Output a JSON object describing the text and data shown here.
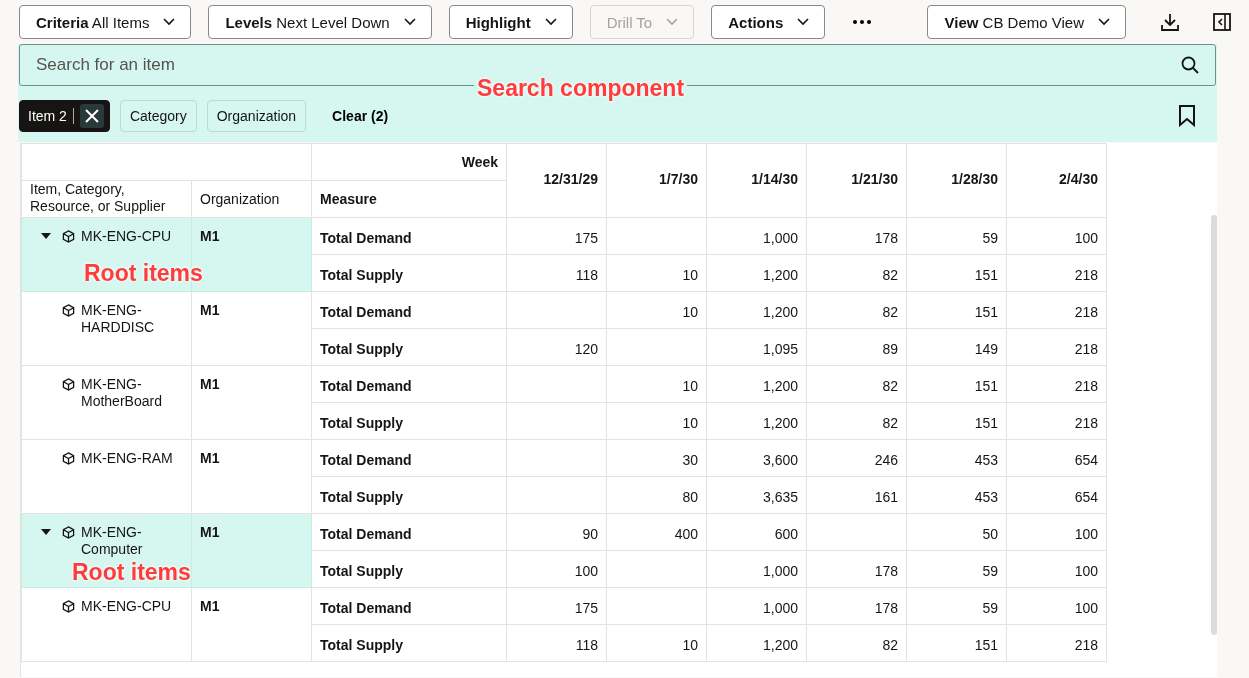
{
  "toolbar": {
    "menus": [
      {
        "label": "Criteria",
        "value": "All Items",
        "disabled": false
      },
      {
        "label": "Levels",
        "value": "Next Level Down",
        "disabled": false
      },
      {
        "label": "Highlight",
        "disabled": false
      },
      {
        "label": "Drill To",
        "disabled": true
      },
      {
        "label": "Actions",
        "disabled": false
      }
    ],
    "view_menu": {
      "label": "View",
      "value": "CB Demo View"
    }
  },
  "search": {
    "placeholder": "Search for an item",
    "annotation": "Search component",
    "filters": [
      {
        "label": "Item 2",
        "selected": true
      },
      {
        "label": "Category",
        "selected": false
      },
      {
        "label": "Organization",
        "selected": false
      }
    ],
    "clear": "Clear (2)"
  },
  "table": {
    "week_label": "Week",
    "columns": [
      "Item, Category, Resource, or Supplier",
      "Organization",
      "Measure"
    ],
    "dates": [
      "12/31/29",
      "1/7/30",
      "1/14/30",
      "1/21/30",
      "1/28/30",
      "2/4/30"
    ],
    "rows": [
      {
        "item": "MK-ENG-CPU",
        "org": "M1",
        "expanded": true,
        "annotation": "Root items",
        "measures": [
          {
            "name": "Total Demand",
            "values": {
              "week_1": "175",
              "week_3": "1,000",
              "week_4": "178",
              "week_5": "59",
              "week_6": "100"
            }
          },
          {
            "name": "Total Supply",
            "values": {
              "week_1": "118",
              "week_2": "10",
              "week_3": "1,200",
              "week_4": "82",
              "week_5": "151",
              "week_6": "218"
            }
          }
        ],
        "children": [
          {
            "item": "MK-ENG-HARDDISC",
            "org": "M1",
            "measures": [
              {
                "name": "Total Demand",
                "values": {
                  "week_2": "10",
                  "week_3": "1,200",
                  "week_4": "82",
                  "week_5": "151",
                  "week_6": "218"
                }
              },
              {
                "name": "Total Supply",
                "values": {
                  "week_1": "120",
                  "week_3": "1,095",
                  "week_4": "89",
                  "week_5": "149",
                  "week_6": "218"
                }
              }
            ]
          },
          {
            "item": "MK-ENG-MotherBoard",
            "org": "M1",
            "measures": [
              {
                "name": "Total Demand",
                "values": {
                  "week_2": "10",
                  "week_3": "1,200",
                  "week_4": "82",
                  "week_5": "151",
                  "week_6": "218"
                }
              },
              {
                "name": "Total Supply",
                "values": {
                  "week_2": "10",
                  "week_3": "1,200",
                  "week_4": "82",
                  "week_5": "151",
                  "week_6": "218"
                }
              }
            ]
          },
          {
            "item": "MK-ENG-RAM",
            "org": "M1",
            "measures": [
              {
                "name": "Total Demand",
                "values": {
                  "week_2": "30",
                  "week_3": "3,600",
                  "week_4": "246",
                  "week_5": "453",
                  "week_6": "654"
                }
              },
              {
                "name": "Total Supply",
                "values": {
                  "week_2": "80",
                  "week_3": "3,635",
                  "week_4": "161",
                  "week_5": "453",
                  "week_6": "654"
                }
              }
            ]
          }
        ]
      },
      {
        "item": "MK-ENG-Computer",
        "org": "M1",
        "expanded": true,
        "annotation": "Root items",
        "measures": [
          {
            "name": "Total Demand",
            "values": {
              "week_1": "90",
              "week_2": "400",
              "week_3": "600",
              "week_5": "50",
              "week_6": "100"
            }
          },
          {
            "name": "Total Supply",
            "values": {
              "week_1": "100",
              "week_3": "1,000",
              "week_4": "178",
              "week_5": "59",
              "week_6": "100"
            }
          }
        ],
        "children": [
          {
            "item": "MK-ENG-CPU",
            "org": "M1",
            "measures": [
              {
                "name": "Total Demand",
                "values": {
                  "week_1": "175",
                  "week_3": "1,000",
                  "week_4": "178",
                  "week_5": "59",
                  "week_6": "100"
                }
              },
              {
                "name": "Total Supply",
                "values": {
                  "week_1": "118",
                  "week_2": "10",
                  "week_3": "1,200",
                  "week_4": "82",
                  "week_5": "151",
                  "week_6": "218"
                }
              }
            ]
          }
        ]
      }
    ]
  }
}
